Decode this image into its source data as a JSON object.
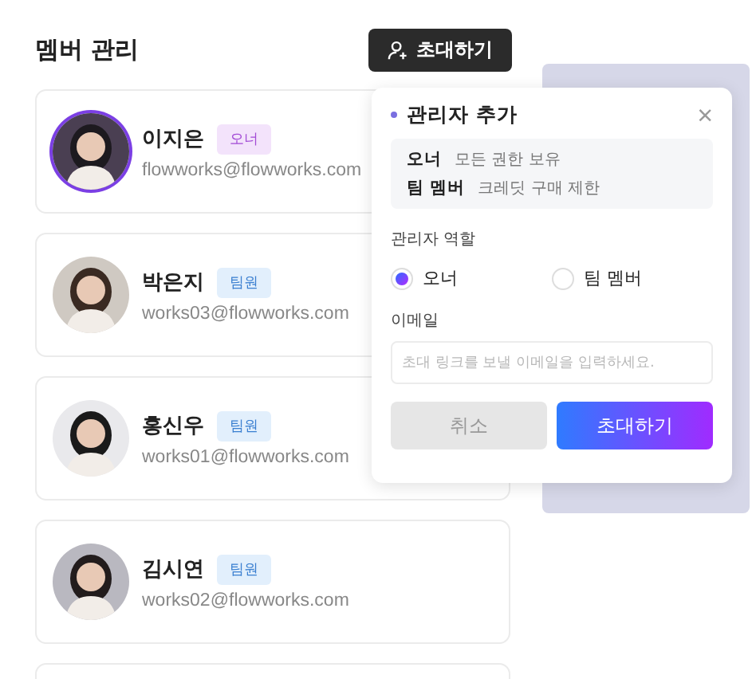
{
  "page": {
    "title": "멤버 관리",
    "invite_button": "초대하기"
  },
  "members": [
    {
      "name": "이지은",
      "email": "flowworks@flowworks.com",
      "kind": "owner",
      "badge": {
        "text": "오너",
        "color": "#f3e3fb"
      }
    },
    {
      "name": "박은지",
      "email": "works03@flowworks.com",
      "kind": "member",
      "badge": {
        "text": "팀원",
        "color": "#e2effc"
      }
    },
    {
      "name": "홍신우",
      "email": "works01@flowworks.com",
      "kind": "member",
      "badge": {
        "text": "팀원",
        "color": "#e2effc"
      }
    },
    {
      "name": "김시연",
      "email": "works02@flowworks.com",
      "kind": "member",
      "badge": {
        "text": "팀원",
        "color": "#e2effc"
      }
    }
  ],
  "dialog": {
    "title": "관리자 추가",
    "close": "×",
    "roles_info": [
      {
        "role": "오너",
        "desc": "모든 권한 보유"
      },
      {
        "role": "팀 멤버",
        "desc": "크레딧 구매 제한"
      }
    ],
    "role_label": "관리자 역할",
    "role_options": [
      {
        "label": "오너",
        "selected": true
      },
      {
        "label": "팀 멤버",
        "selected": false
      }
    ],
    "email_label": "이메일",
    "email_placeholder": "초대 링크를 보낼 이메일을 입력하세요.",
    "cancel": "취소",
    "submit": "초대하기"
  }
}
